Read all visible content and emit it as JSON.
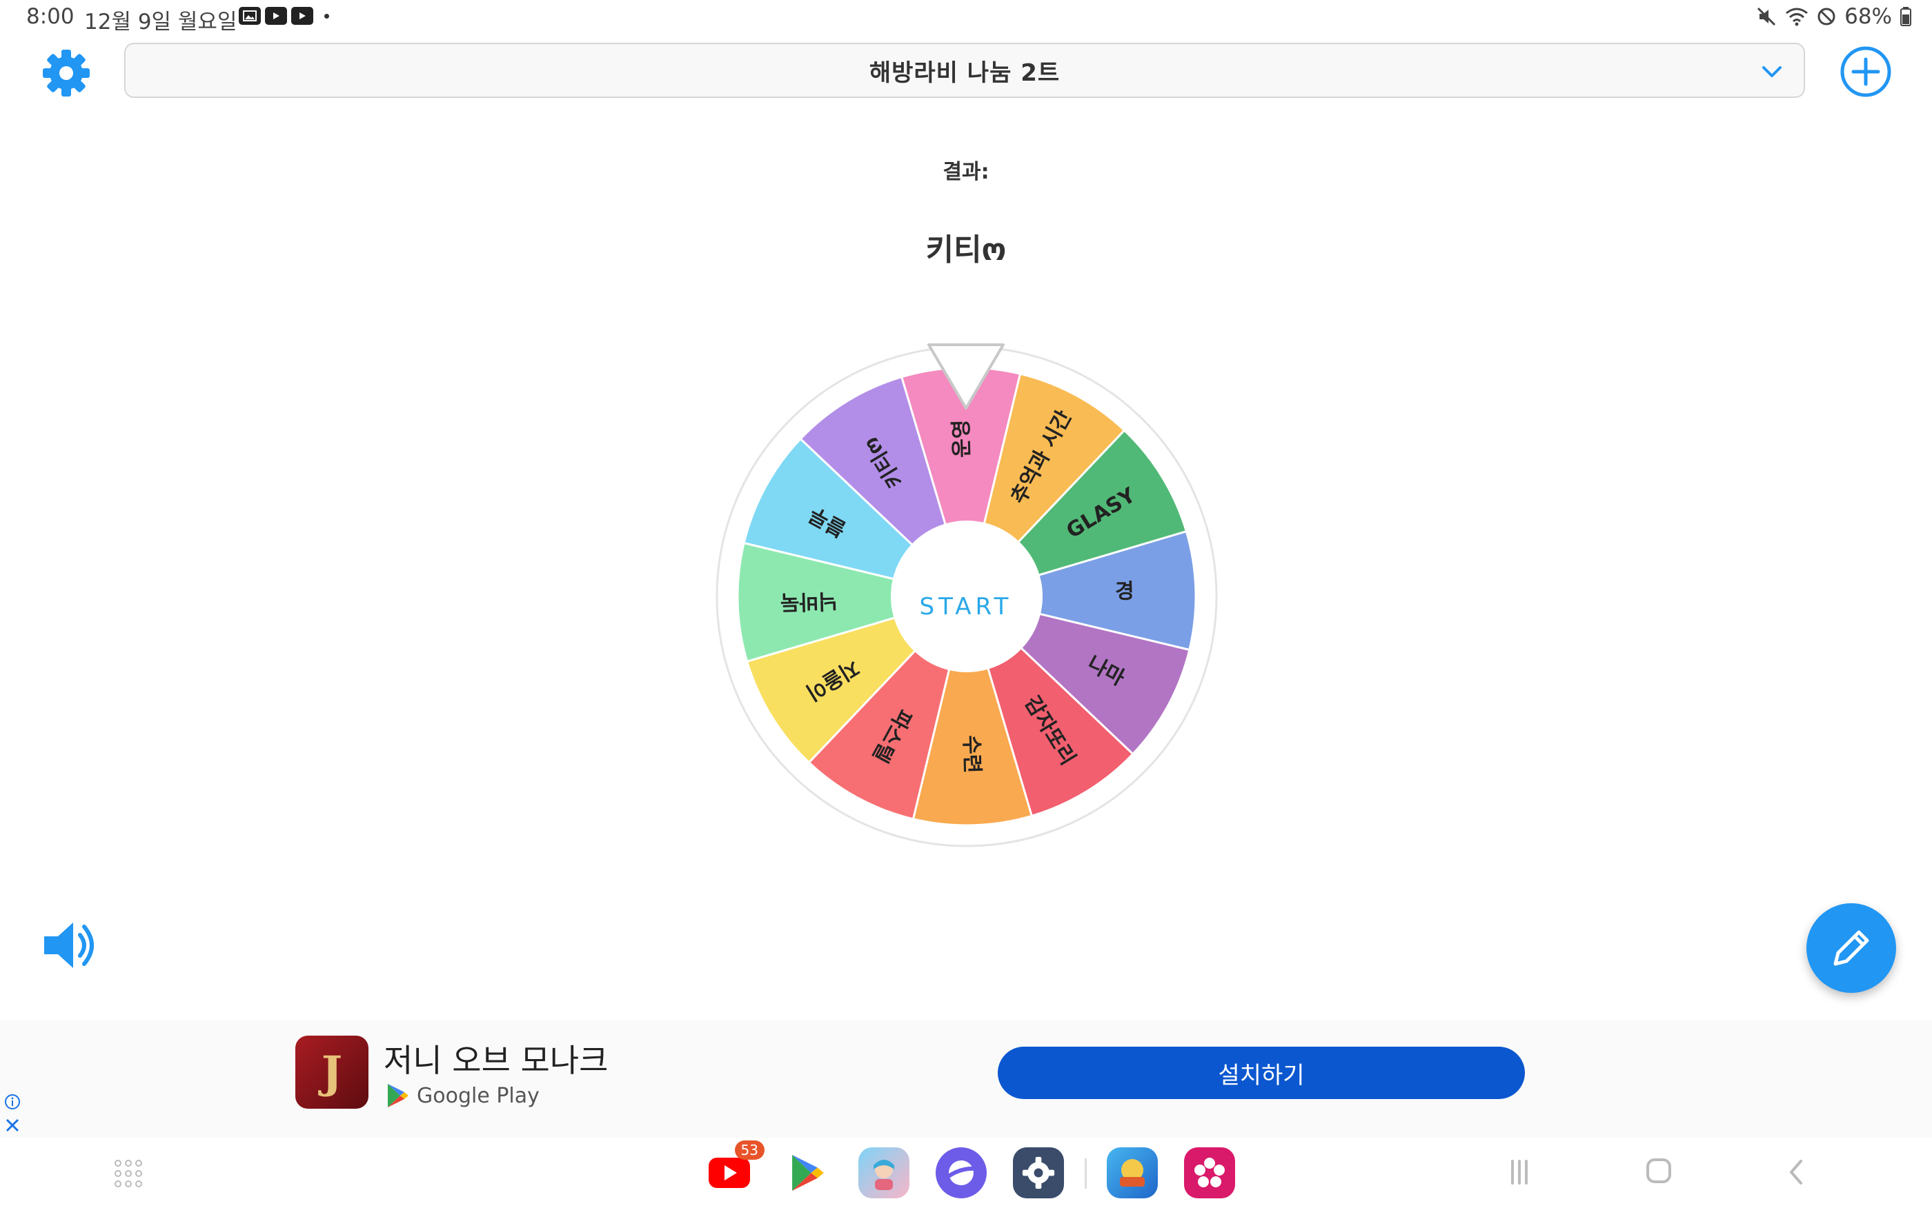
{
  "status_bar": {
    "time": "8:00",
    "date": "12월 9일 월요일",
    "battery": "68%"
  },
  "header": {
    "title": "해방라비 나눔 2트"
  },
  "result": {
    "label": "결과:",
    "value": "키티ო"
  },
  "wheel": {
    "start_label": "START",
    "segments": [
      {
        "label": "운영",
        "color": "#f48abf"
      },
      {
        "label": "추억과 시간",
        "color": "#f9bb53"
      },
      {
        "label": "GLASY",
        "color": "#51b977"
      },
      {
        "label": "경",
        "color": "#7b9fe6"
      },
      {
        "label": "나마",
        "color": "#b275c4"
      },
      {
        "label": "감자또리",
        "color": "#f25f6f"
      },
      {
        "label": "수련",
        "color": "#f9a94f"
      },
      {
        "label": "파스텔",
        "color": "#f76f73"
      },
      {
        "label": "지올이",
        "color": "#f9df60"
      },
      {
        "label": "닉바둑",
        "color": "#8de8b0"
      },
      {
        "label": "블루",
        "color": "#7fd9f5"
      },
      {
        "label": "키티ო",
        "color": "#b28ee8"
      }
    ]
  },
  "ad": {
    "app_name": "저니 오브 모나크",
    "store": "Google Play",
    "install_label": "설치하기",
    "icon_letter": "J"
  },
  "dock": {
    "youtube_badge": "53"
  }
}
